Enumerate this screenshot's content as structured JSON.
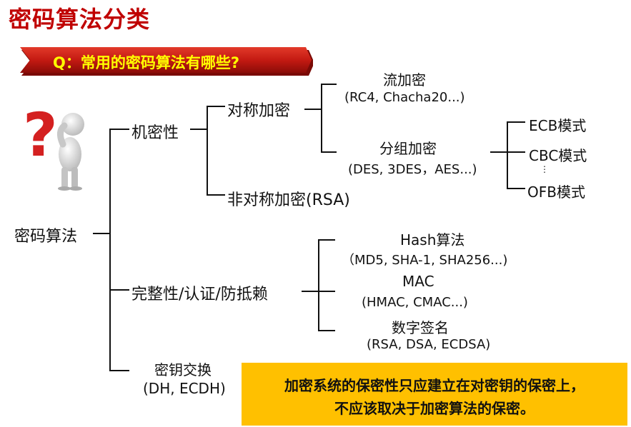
{
  "title": "密码算法分类",
  "banner": {
    "text": "Q：常用的密码算法有哪些?"
  },
  "tree": {
    "root": "密码算法",
    "confidentiality": {
      "label": "机密性",
      "symmetric": {
        "label": "对称加密",
        "stream": {
          "label": "流加密",
          "examples": "(RC4, Chacha20...)"
        },
        "block": {
          "label": "分组加密",
          "examples": "(DES, 3DES，AES...)",
          "modes": {
            "ecb": "ECB模式",
            "cbc": "CBC模式",
            "dots": "⋮",
            "ofb": "OFB模式"
          }
        }
      },
      "asymmetric": {
        "label": "非对称加密(RSA)"
      }
    },
    "integrity": {
      "label": "完整性/认证/防抵赖",
      "hash": {
        "label": "Hash算法",
        "examples": "（MD5, SHA-1, SHA256...)"
      },
      "mac": {
        "label": "MAC",
        "examples": "(HMAC, CMAC...)"
      },
      "signature": {
        "label": "数字签名",
        "examples": "(RSA, DSA, ECDSA)"
      }
    },
    "key_exchange": {
      "label": "密钥交换",
      "examples": "(DH, ECDH)"
    }
  },
  "callout": {
    "line1": "加密系统的保密性只应建立在对密钥的保密上，",
    "line2": "不应该取决于加密算法的保密。"
  }
}
